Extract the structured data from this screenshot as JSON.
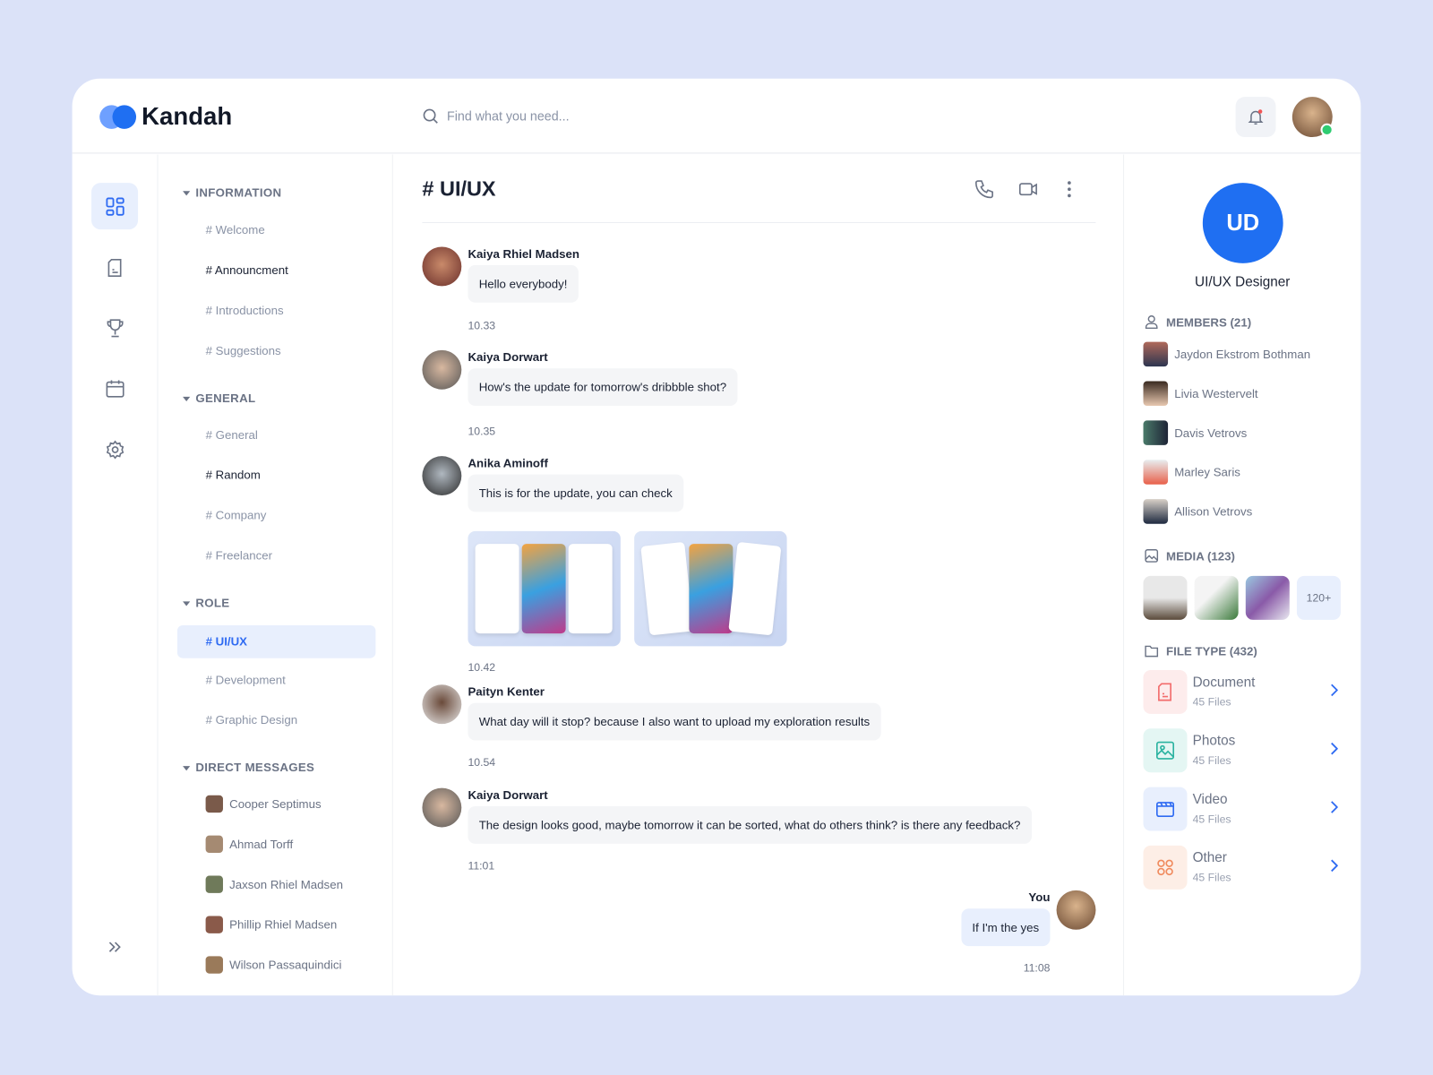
{
  "app": {
    "name": "Kandah",
    "search_placeholder": "Find what you need..."
  },
  "colors": {
    "accent": "#1f6ff2",
    "background": "#dbe2f8"
  },
  "rail": {
    "icons": [
      "dashboard-icon",
      "document-icon",
      "trophy-icon",
      "calendar-icon",
      "settings-icon"
    ],
    "expand": "chevrons-right-icon"
  },
  "sidebar": {
    "sections": [
      {
        "title": "INFORMATION",
        "items": [
          "# Welcome",
          "# Announcment",
          "# Introductions",
          "# Suggestions"
        ]
      },
      {
        "title": "GENERAL",
        "items": [
          "# General",
          "# Random",
          "# Company",
          "# Freelancer"
        ]
      },
      {
        "title": "ROLE",
        "items": [
          "# UI/UX",
          "# Development",
          "# Graphic Design"
        ]
      },
      {
        "title": "DIRECT MESSAGES",
        "items": [
          "Cooper Septimus",
          "Ahmad Torff",
          "Jaxson Rhiel Madsen",
          "Phillip Rhiel Madsen",
          "Wilson Passaquindici"
        ]
      }
    ]
  },
  "chat": {
    "title": "# UI/UX",
    "messages": [
      {
        "name": "Kaiya Rhiel Madsen",
        "text": "Hello everybody!",
        "time": "10.33"
      },
      {
        "name": "Kaiya Dorwart",
        "text": "How's the update for tomorrow's dribbble shot?",
        "time": "10.35"
      },
      {
        "name": "Anika Aminoff",
        "text": "This is for the update, you can check",
        "time": "10.42"
      },
      {
        "name": "Paityn Kenter",
        "text": "What day will it stop? because I also want to upload my exploration results",
        "time": "10.54"
      },
      {
        "name": "Kaiya Dorwart",
        "text": "The design looks good, maybe tomorrow it can be sorted, what do others think? is there any feedback?",
        "time": "11:01"
      },
      {
        "name": "You",
        "text": "If I'm the yes",
        "time": "11:08"
      }
    ]
  },
  "details": {
    "initials": "UD",
    "name": "UI/UX Designer",
    "members_title": "MEMBERS (21)",
    "members": [
      "Jaydon Ekstrom Bothman",
      "Livia Westervelt",
      "Davis Vetrovs",
      "Marley Saris",
      "Allison Vetrovs"
    ],
    "media_title": "MEDIA (123)",
    "media_more": "120+",
    "files_title": "FILE TYPE (432)",
    "files": [
      {
        "name": "Document",
        "count": "45 Files",
        "color": "#f26b6b"
      },
      {
        "name": "Photos",
        "count": "45 Files",
        "color": "#2bb3a0"
      },
      {
        "name": "Video",
        "count": "45 Files",
        "color": "#2f6bf2"
      },
      {
        "name": "Other",
        "count": "45 Files",
        "color": "#f08a5d"
      }
    ]
  }
}
